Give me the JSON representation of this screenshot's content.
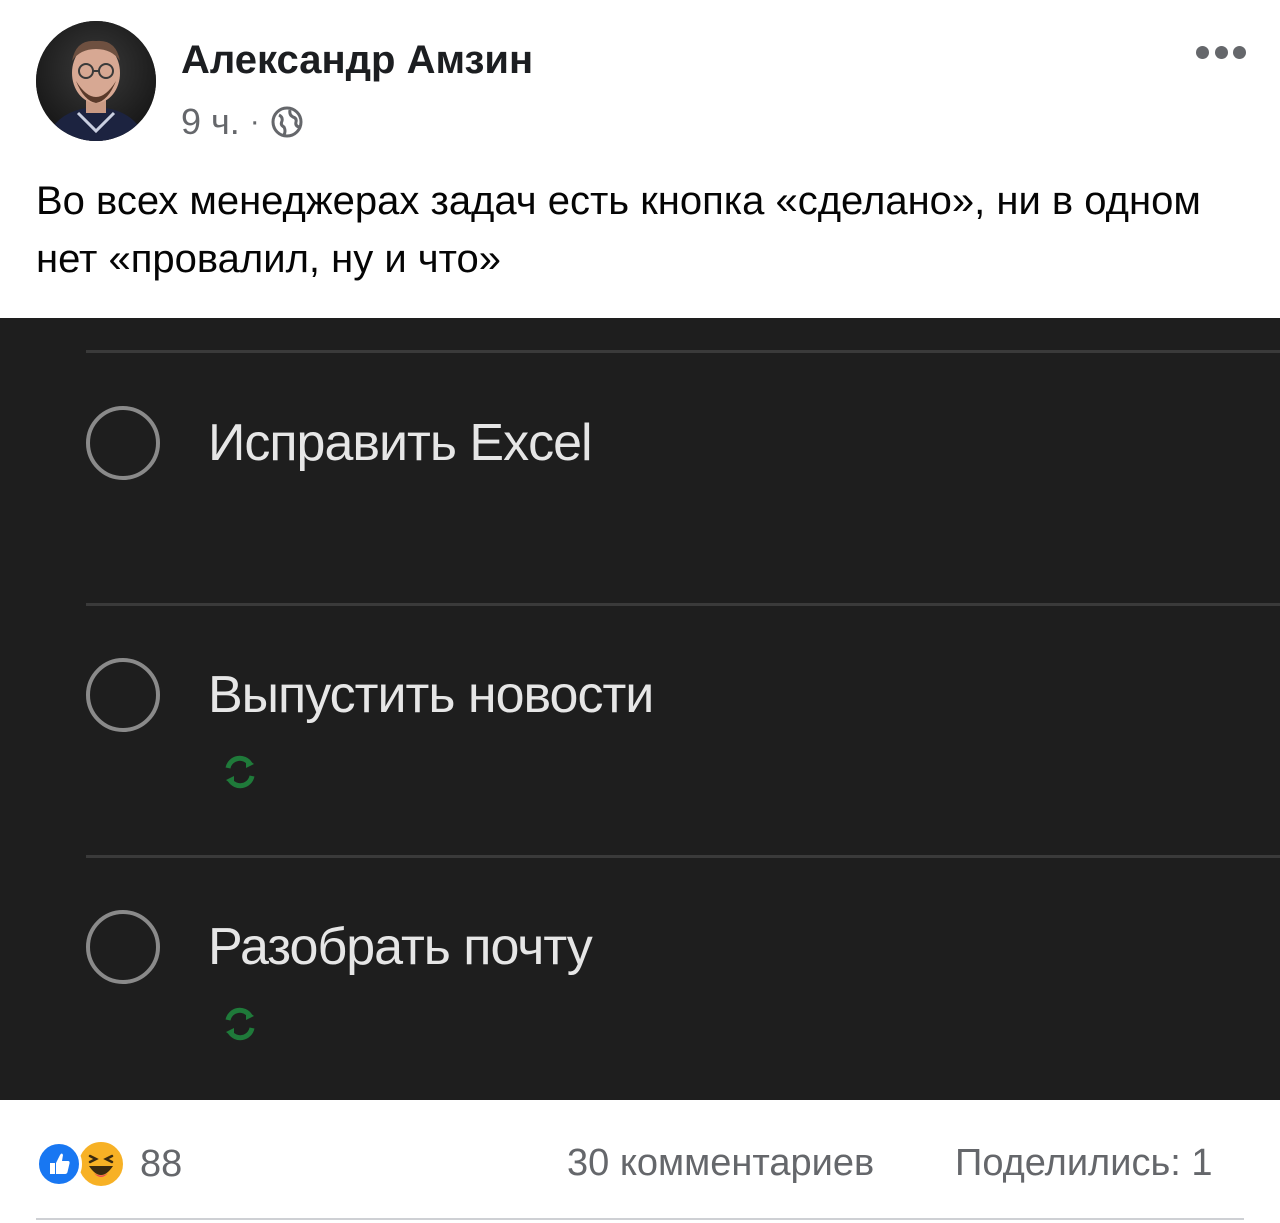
{
  "author": {
    "name": "Александр Амзин",
    "time": "9 ч.",
    "separator": "·",
    "privacy_icon": "globe-icon"
  },
  "post": {
    "text": "Во всех менеджерах задач есть кнопка «сделано», ни в одном нет «провалил, ну и что»"
  },
  "media": {
    "tasks": [
      {
        "title": "Исправить Excel",
        "repeat": false
      },
      {
        "title": "Выпустить новости",
        "repeat": true
      },
      {
        "title": "Разобрать почту",
        "repeat": true
      }
    ],
    "colors": {
      "background": "#1e1e1e",
      "text": "#e6e6e6",
      "repeat_icon": "#1f7a3a"
    }
  },
  "footer": {
    "reaction_icons": [
      "like-icon",
      "haha-icon"
    ],
    "reaction_count": "88",
    "comments": "30 комментариев",
    "shares": "Поделились: 1"
  },
  "colors": {
    "like": "#1877f2",
    "haha": "#f7b125",
    "secondary_text": "#65676b"
  }
}
